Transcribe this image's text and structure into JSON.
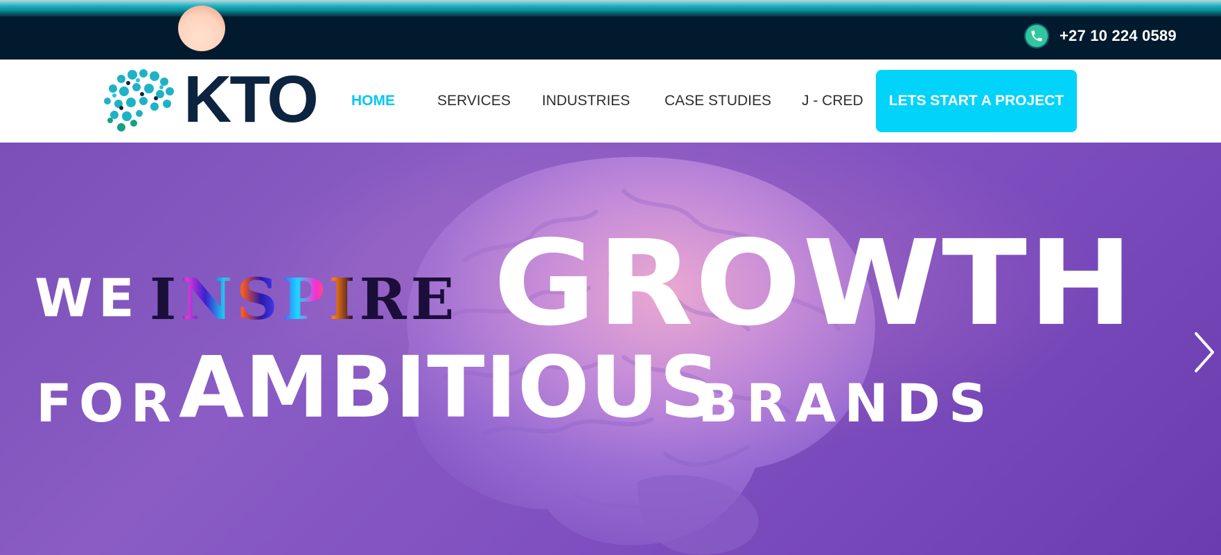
{
  "topbar": {
    "phone": "+27 10 224 0589",
    "icons": {
      "phone": "phone-icon"
    },
    "colors": {
      "background": "#021a2d",
      "phone_icon": "#33c5a0"
    }
  },
  "brand": {
    "logo_text": "KTO",
    "colors": {
      "logo_text": "#0d2440",
      "logo_dots": "#1fb2c7"
    }
  },
  "nav": {
    "items": [
      {
        "label": "HOME",
        "active": true
      },
      {
        "label": "SERVICES",
        "active": false
      },
      {
        "label": "INDUSTRIES",
        "active": false
      },
      {
        "label": "CASE STUDIES",
        "active": false
      },
      {
        "label": "J - CRED",
        "active": false
      }
    ],
    "cta_label": "LETS START A PROJECT",
    "colors": {
      "active": "#00c8f2",
      "cta": "#01d3fa"
    }
  },
  "hero": {
    "line1": {
      "w1": "WE",
      "w2": "INSPIRE",
      "w3": "GROWTH"
    },
    "line2": {
      "w1": "FOR",
      "w2": "AMBITIOUS",
      "w3": "BRANDS"
    },
    "icons": {
      "next": "chevron-right-icon"
    },
    "colors": {
      "background": "#7f4fc0",
      "text": "#ffffff"
    }
  }
}
